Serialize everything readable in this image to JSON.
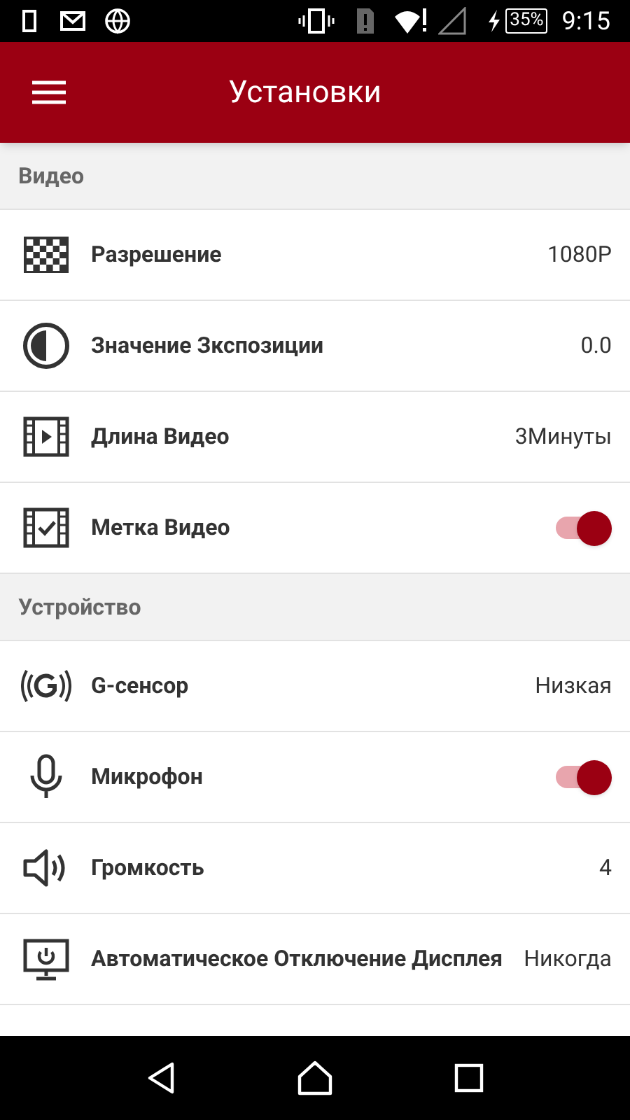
{
  "status_bar": {
    "battery": "35%",
    "time": "9:15"
  },
  "app_bar": {
    "title": "Установки"
  },
  "sections": [
    {
      "title": "Видео",
      "rows": [
        {
          "kind": "value",
          "label": "Разрешение",
          "value": "1080P"
        },
        {
          "kind": "value",
          "label": "Значение Зкспозиции",
          "value": "0.0"
        },
        {
          "kind": "value",
          "label": "Длина Видео",
          "value": "3Минуты"
        },
        {
          "kind": "toggle",
          "label": "Метка Видео",
          "on": true
        }
      ]
    },
    {
      "title": "Устройство",
      "rows": [
        {
          "kind": "value",
          "label": "G-сенсор",
          "value": "Низкая"
        },
        {
          "kind": "toggle",
          "label": "Микрофон",
          "on": true
        },
        {
          "kind": "value",
          "label": "Громкость",
          "value": "4"
        },
        {
          "kind": "value",
          "label": "Автоматическое Отключение Дисплея",
          "value": "Никогда"
        }
      ]
    }
  ]
}
